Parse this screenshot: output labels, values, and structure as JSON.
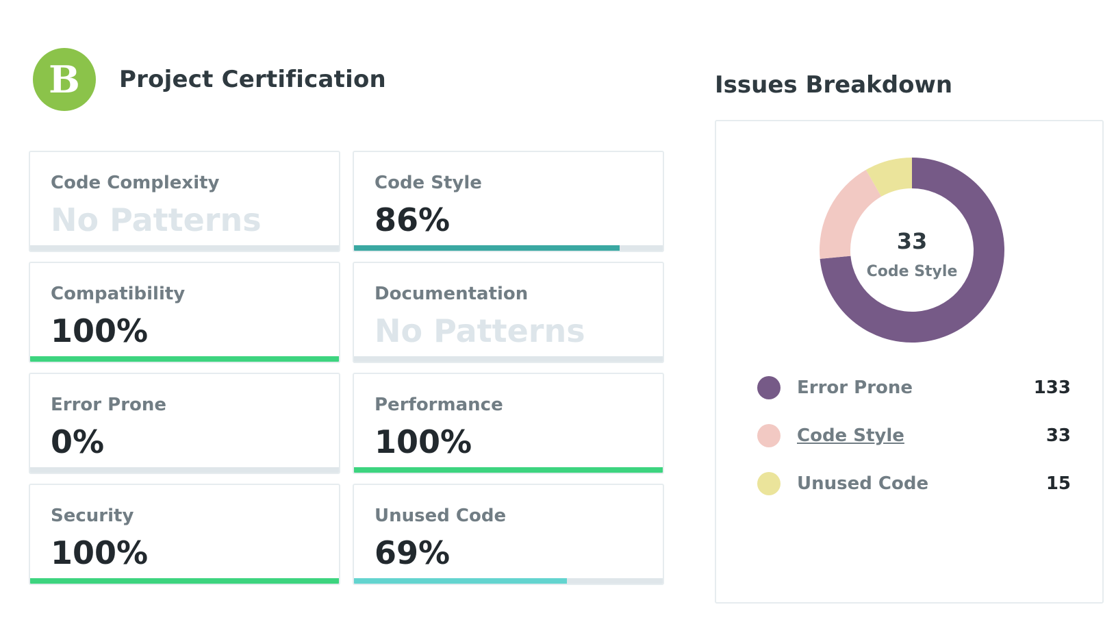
{
  "certification": {
    "grade": "B",
    "grade_color": "#8bc34a",
    "title": "Project Certification"
  },
  "metrics": [
    {
      "label": "Code Complexity",
      "value": "No Patterns",
      "percent": null,
      "bar_color": "#dfe6ea"
    },
    {
      "label": "Code Style",
      "value": "86%",
      "percent": 86,
      "bar_color": "#3aa8a2"
    },
    {
      "label": "Compatibility",
      "value": "100%",
      "percent": 100,
      "bar_color": "#3dd47f"
    },
    {
      "label": "Documentation",
      "value": "No Patterns",
      "percent": null,
      "bar_color": "#dfe6ea"
    },
    {
      "label": "Error Prone",
      "value": "0%",
      "percent": 0,
      "bar_color": "#3dd47f"
    },
    {
      "label": "Performance",
      "value": "100%",
      "percent": 100,
      "bar_color": "#3dd47f"
    },
    {
      "label": "Security",
      "value": "100%",
      "percent": 100,
      "bar_color": "#3dd47f"
    },
    {
      "label": "Unused Code",
      "value": "69%",
      "percent": 69,
      "bar_color": "#63d4cf"
    }
  ],
  "issues": {
    "title": "Issues Breakdown",
    "center_value": "33",
    "center_label": "Code Style",
    "items": [
      {
        "label": "Error Prone",
        "count": 133,
        "color": "#765a87"
      },
      {
        "label": "Code Style",
        "count": 33,
        "color": "#f2c9c3"
      },
      {
        "label": "Unused Code",
        "count": 15,
        "color": "#ebe49b"
      }
    ]
  },
  "chart_data": {
    "type": "pie",
    "categories": [
      "Error Prone",
      "Code Style",
      "Unused Code"
    ],
    "values": [
      133,
      33,
      15
    ],
    "colors": [
      "#765a87",
      "#f2c9c3",
      "#ebe49b"
    ],
    "title": "Issues Breakdown",
    "legend": "bottom"
  }
}
